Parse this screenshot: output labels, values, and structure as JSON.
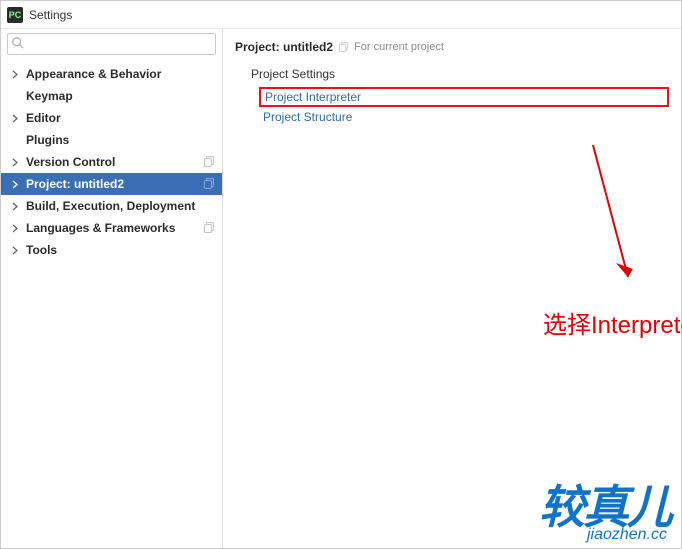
{
  "window": {
    "title": "Settings"
  },
  "search": {
    "placeholder": ""
  },
  "sidebar": {
    "items": [
      {
        "label": "Appearance & Behavior",
        "expandable": true,
        "showCopy": false,
        "selected": false
      },
      {
        "label": "Keymap",
        "expandable": false,
        "showCopy": false,
        "selected": false
      },
      {
        "label": "Editor",
        "expandable": true,
        "showCopy": false,
        "selected": false
      },
      {
        "label": "Plugins",
        "expandable": false,
        "showCopy": false,
        "selected": false
      },
      {
        "label": "Version Control",
        "expandable": true,
        "showCopy": true,
        "selected": false
      },
      {
        "label": "Project: untitled2",
        "expandable": true,
        "showCopy": true,
        "selected": true
      },
      {
        "label": "Build, Execution, Deployment",
        "expandable": true,
        "showCopy": false,
        "selected": false
      },
      {
        "label": "Languages & Frameworks",
        "expandable": true,
        "showCopy": true,
        "selected": false
      },
      {
        "label": "Tools",
        "expandable": true,
        "showCopy": false,
        "selected": false
      }
    ]
  },
  "content": {
    "breadcrumb": "Project: untitled2",
    "badge": "For current project",
    "sectionTitle": "Project Settings",
    "links": [
      {
        "label": "Project Interpreter",
        "highlighted": true
      },
      {
        "label": "Project Structure",
        "highlighted": false
      }
    ]
  },
  "annotation": {
    "text": "选择Interpreter"
  },
  "watermark": {
    "big": "较真儿",
    "small": "jiaozhen.cc"
  },
  "colors": {
    "selection": "#3b6fb5",
    "link": "#2b6cb0",
    "accentRed": "#e30000"
  }
}
